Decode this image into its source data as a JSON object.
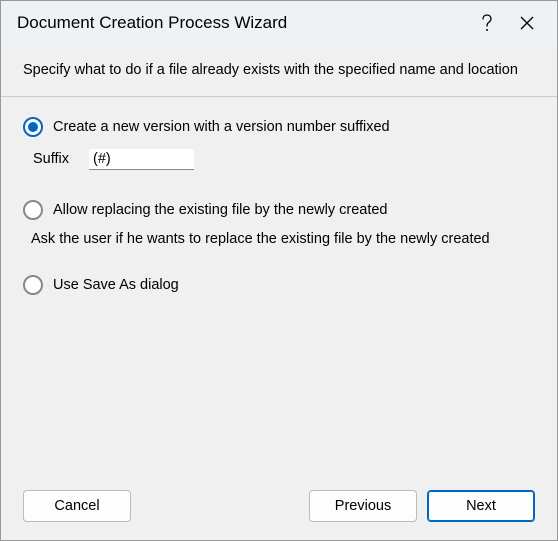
{
  "dialog": {
    "title": "Document Creation Process Wizard",
    "header_text": "Specify what to do if a file already exists with the specified name and location"
  },
  "options": {
    "create_version": {
      "label": "Create a new version with a version number suffixed",
      "selected": true
    },
    "suffix": {
      "label": "Suffix",
      "value": "(#)"
    },
    "allow_replace": {
      "label": "Allow replacing the existing file by the newly created",
      "selected": false,
      "sub_text": "Ask the user if he wants to replace the existing file by the newly created"
    },
    "save_as": {
      "label": "Use Save As dialog",
      "selected": false
    }
  },
  "buttons": {
    "cancel": "Cancel",
    "previous": "Previous",
    "next": "Next"
  }
}
